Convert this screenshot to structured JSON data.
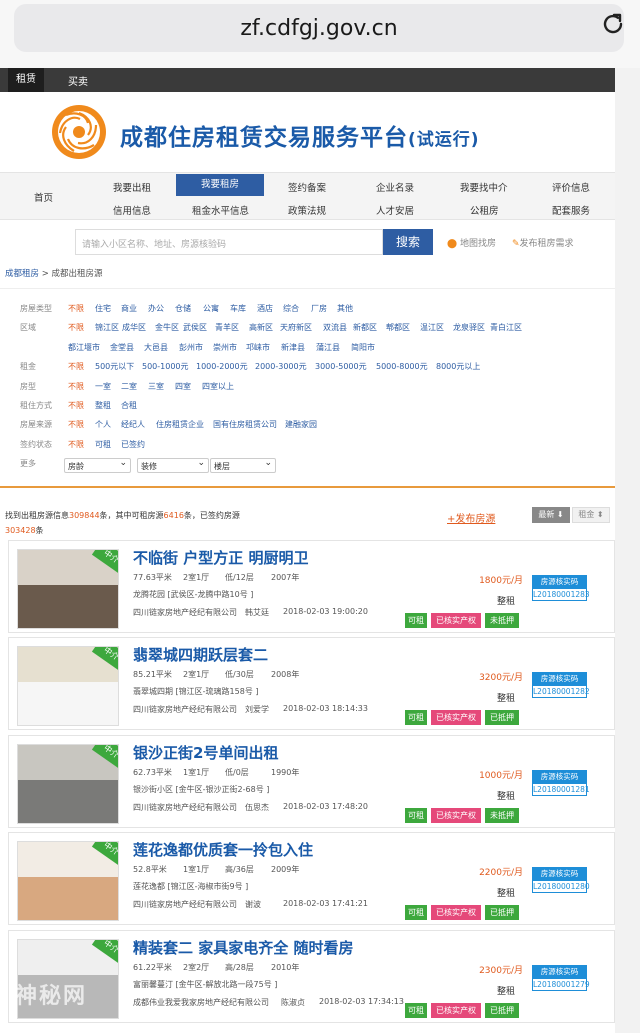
{
  "browser": {
    "url": "zf.cdfgj.gov.cn"
  },
  "top_tabs": [
    "租赁",
    "买卖"
  ],
  "site": {
    "title": "成都住房租赁交易服务平台",
    "subtitle": "(试运行)"
  },
  "nav": {
    "home": "首页",
    "row1": [
      "我要出租",
      "我要租房",
      "签约备案",
      "企业名录",
      "我要找中介",
      "评价信息"
    ],
    "row2": [
      "信用信息",
      "租金水平信息",
      "政策法规",
      "人才安居",
      "公租房",
      "配套服务"
    ],
    "active": "我要租房"
  },
  "search": {
    "placeholder": "请输入小区名称、地址、房源核验码",
    "button": "搜索",
    "map": "地图找房",
    "publish_demand": "发布租房需求"
  },
  "breadcrumb": {
    "root": "成都租房",
    "current": "成都出租房源"
  },
  "filters": {
    "type": {
      "label": "房屋类型",
      "options": [
        "不限",
        "住宅",
        "商业",
        "办公",
        "仓储",
        "公寓",
        "车库",
        "酒店",
        "综合",
        "厂房",
        "其他"
      ]
    },
    "area": {
      "label": "区域",
      "options": [
        "不限",
        "锦江区",
        "成华区",
        "金牛区",
        "武侯区",
        "青羊区",
        "高新区",
        "天府新区",
        "双流县",
        "新都区",
        "郫都区",
        "温江区",
        "龙泉驿区",
        "青白江区"
      ],
      "options2": [
        "都江堰市",
        "金堂县",
        "大邑县",
        "彭州市",
        "崇州市",
        "邛崃市",
        "新津县",
        "蒲江县",
        "简阳市"
      ]
    },
    "rent": {
      "label": "租金",
      "options": [
        "不限",
        "500元以下",
        "500-1000元",
        "1000-2000元",
        "2000-3000元",
        "3000-5000元",
        "5000-8000元",
        "8000元以上"
      ]
    },
    "layout": {
      "label": "房型",
      "options": [
        "不限",
        "一室",
        "二室",
        "三室",
        "四室",
        "四室以上"
      ]
    },
    "mode": {
      "label": "租住方式",
      "options": [
        "不限",
        "整租",
        "合租"
      ]
    },
    "source": {
      "label": "房屋来源",
      "options": [
        "不限",
        "个人",
        "经纪人",
        "住房租赁企业",
        "国有住房租赁公司",
        "建融家园"
      ]
    },
    "sign": {
      "label": "签约状态",
      "options": [
        "不限",
        "可租",
        "已签约"
      ]
    },
    "more": {
      "label": "更多",
      "selects": [
        "房龄",
        "装修",
        "楼层"
      ]
    }
  },
  "stats": {
    "prefix": "找到出租房源信息",
    "total": "309844",
    "mid1": "条，其中可租房源",
    "available": "6416",
    "mid2": "条，已签约房源",
    "signed": "303428",
    "suffix": "条"
  },
  "toolbar": {
    "publish": "+发布房源",
    "sort_new": "最新 ⬇",
    "sort_rent": "租金 ⬍"
  },
  "listings": [
    {
      "title": "不临街 户型方正 明厨明卫",
      "area": "77.63平米",
      "layout": "2室1厅",
      "floor": "低/12层",
      "year": "2007年",
      "addr": "龙腾花园 [武侯区-龙腾中路10号 ]",
      "agency": "四川链家房地产经纪有限公司",
      "agent": "韩艾廷",
      "time": "2018-02-03 19:00:20",
      "price": "1800元/月",
      "type": "整租",
      "tags": [
        "可租",
        "已核实产权",
        "未抵押"
      ],
      "code": "L20180001283",
      "ribbon": "中介"
    },
    {
      "title": "翡翠城四期跃层套二",
      "area": "85.21平米",
      "layout": "2室1厅",
      "floor": "低/30层",
      "year": "2008年",
      "addr": "翡翠城四期 [锦江区-琉璃路158号 ]",
      "agency": "四川链家房地产经纪有限公司",
      "agent": "刘爱学",
      "time": "2018-02-03 18:14:33",
      "price": "3200元/月",
      "type": "整租",
      "tags": [
        "可租",
        "已核实产权",
        "已抵押"
      ],
      "code": "L20180001282",
      "ribbon": "中介"
    },
    {
      "title": "银沙正街2号单间出租",
      "area": "62.73平米",
      "layout": "1室1厅",
      "floor": "低/0层",
      "year": "1990年",
      "addr": "银沙街小区 [金牛区-银沙正街2-68号 ]",
      "agency": "四川链家房地产经纪有限公司",
      "agent": "伍思杰",
      "time": "2018-02-03 17:48:20",
      "price": "1000元/月",
      "type": "整租",
      "tags": [
        "可租",
        "已核实产权",
        "未抵押"
      ],
      "code": "L20180001281",
      "ribbon": "中介"
    },
    {
      "title": "莲花逸都优质套一拎包入住",
      "area": "52.8平米",
      "layout": "1室1厅",
      "floor": "高/36层",
      "year": "2009年",
      "addr": "莲花逸都 [锦江区-海椒市街9号 ]",
      "agency": "四川链家房地产经纪有限公司",
      "agent": "谢波",
      "time": "2018-02-03 17:41:21",
      "price": "2200元/月",
      "type": "整租",
      "tags": [
        "可租",
        "已核实产权",
        "已抵押"
      ],
      "code": "L20180001280",
      "ribbon": "中介"
    },
    {
      "title": "精装套二 家具家电齐全 随时看房",
      "area": "61.22平米",
      "layout": "2室2厅",
      "floor": "高/28层",
      "year": "2010年",
      "addr": "富丽馨蔓汀 [金牛区-解放北路一段75号 ]",
      "agency": "成都伟业我爱我家房地产经纪有限公司",
      "agent": "陈淑贞",
      "time": "2018-02-03 17:34:13",
      "price": "2300元/月",
      "type": "整租",
      "tags": [
        "可租",
        "已核实产权",
        "已抵押"
      ],
      "code": "L20180001279",
      "ribbon": "中介"
    }
  ],
  "verify_label": "房源核实码",
  "watermark": "神秘网",
  "colors": {
    "brand_blue": "#1a5aa8",
    "nav_active": "#2e5da3",
    "accent_orange": "#e05a1e",
    "tag_green": "#3da83d",
    "tag_pink": "#e5497a",
    "verify_blue": "#1e8ed8"
  }
}
